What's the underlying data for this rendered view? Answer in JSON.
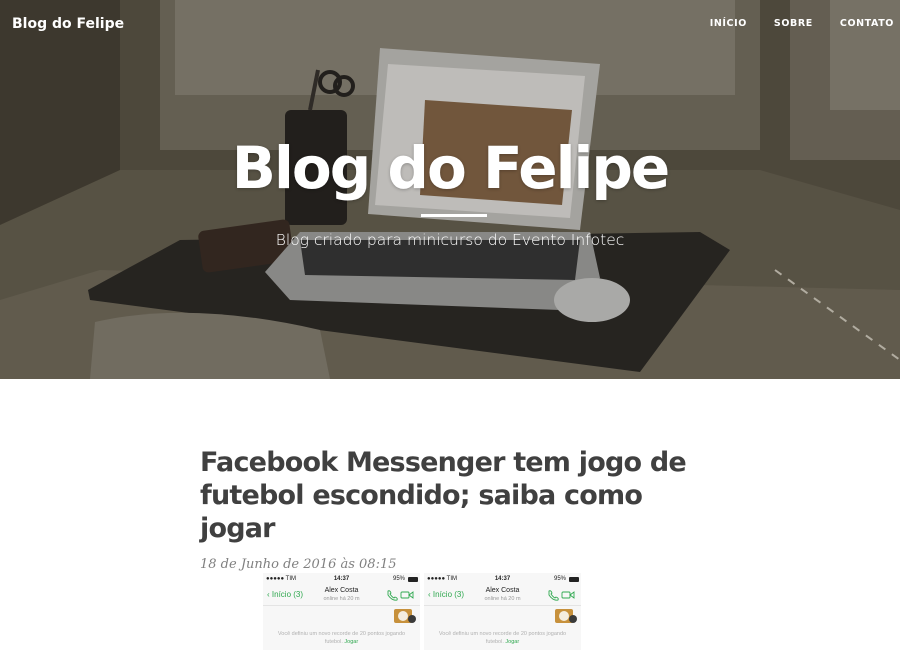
{
  "navbar": {
    "brand": "Blog do Felipe",
    "links": [
      "INÍCIO",
      "SOBRE",
      "CONTATO"
    ]
  },
  "hero": {
    "title": "Blog do Felipe",
    "subtitle": "Blog criado para minicurso do Evento Infotec"
  },
  "post": {
    "title": "Facebook Messenger tem jogo de futebol escondido; saiba como jogar",
    "meta": "18 de Junho de 2016 às 08:15",
    "image": {
      "phones": [
        {
          "carrier": "●●●●● TIM",
          "time": "14:37",
          "battery": "95%",
          "back": "Início (3)",
          "contact": "Alex Costa",
          "status": "online há 20 m",
          "message": "Você definiu um novo recorde de 20 pontos jogando",
          "message_end": "futebol.",
          "action": "Jogar"
        },
        {
          "carrier": "●●●●● TIM",
          "time": "14:37",
          "battery": "95%",
          "back": "Início (3)",
          "contact": "Alex Costa",
          "status": "online há 20 m",
          "message": "Você definiu um novo recorde de 20 pontos jogando",
          "message_end": "futebol.",
          "action": "Jogar"
        }
      ]
    }
  },
  "colors": {
    "text": "#404040",
    "meta": "#808080",
    "accent_green": "#2fa84f",
    "hero_overlay": "#5e5749"
  }
}
